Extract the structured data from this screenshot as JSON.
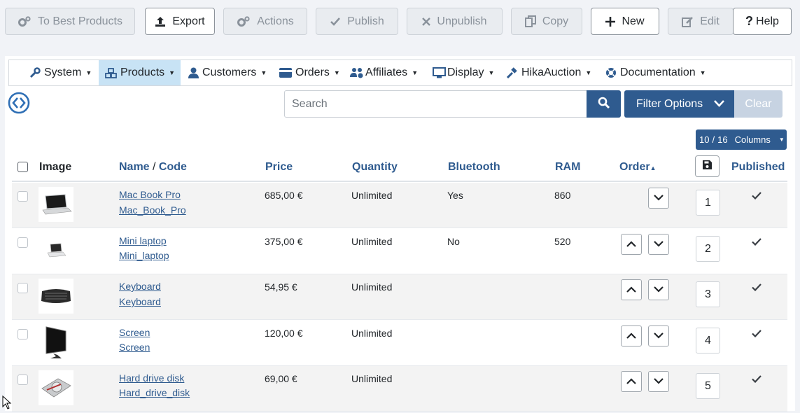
{
  "toolbar": {
    "best_products": "To Best Products",
    "export": "Export",
    "actions": "Actions",
    "publish": "Publish",
    "unpublish": "Unpublish",
    "copy": "Copy",
    "new": "New",
    "edit": "Edit",
    "help": "Help"
  },
  "menu": {
    "system": "System",
    "products": "Products",
    "customers": "Customers",
    "orders": "Orders",
    "affiliates": "Affiliates",
    "display": "Display",
    "hikaauction": "HikaAuction",
    "documentation": "Documentation"
  },
  "filters": {
    "search_placeholder": "Search",
    "filter_options": "Filter Options",
    "clear": "Clear",
    "columns_shown": "10",
    "columns_total": "16",
    "columns_label": "Columns"
  },
  "table": {
    "headers": {
      "image": "Image",
      "name": "Name",
      "name_sep": " / ",
      "code": "Code",
      "price": "Price",
      "quantity": "Quantity",
      "bluetooth": "Bluetooth",
      "ram": "RAM",
      "order": "Order",
      "published": "Published"
    },
    "rows": [
      {
        "name": "Mac Book Pro",
        "code": "Mac_Book_Pro",
        "price": "685,00 €",
        "quantity": "Unlimited",
        "bluetooth": "Yes",
        "ram": "860",
        "order": "1",
        "published": true,
        "image": "laptop-thumbnail"
      },
      {
        "name": "Mini laptop",
        "code": "Mini_laptop",
        "price": "375,00 €",
        "quantity": "Unlimited",
        "bluetooth": "No",
        "ram": "520",
        "order": "2",
        "published": true,
        "image": "mini-laptop-thumbnail"
      },
      {
        "name": "Keyboard",
        "code": "Keyboard",
        "price": "54,95 €",
        "quantity": "Unlimited",
        "bluetooth": "",
        "ram": "",
        "order": "3",
        "published": true,
        "image": "keyboard-thumbnail"
      },
      {
        "name": "Screen",
        "code": "Screen",
        "price": "120,00 €",
        "quantity": "Unlimited",
        "bluetooth": "",
        "ram": "",
        "order": "4",
        "published": true,
        "image": "screen-thumbnail"
      },
      {
        "name": "Hard drive disk",
        "code": "Hard_drive_disk",
        "price": "69,00 €",
        "quantity": "Unlimited",
        "bluetooth": "",
        "ram": "",
        "order": "5",
        "published": true,
        "image": "hard-drive-thumbnail"
      }
    ]
  },
  "colors": {
    "primary": "#2f5b8f",
    "active_menu": "#c8e3f5",
    "disabled_text": "#8a929b"
  }
}
